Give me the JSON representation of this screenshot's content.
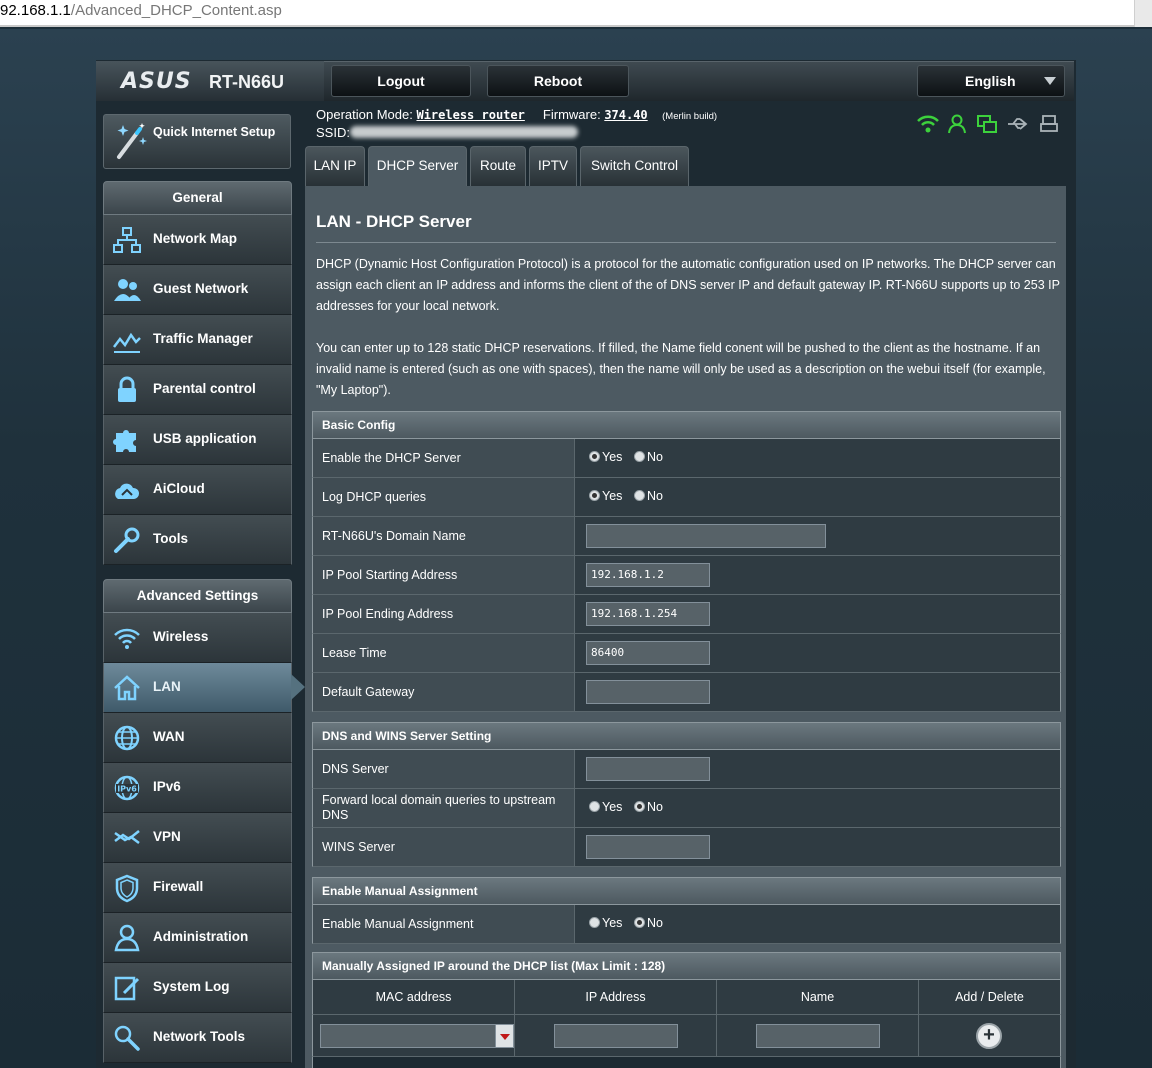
{
  "browser": {
    "url_host": "92.168.1.1",
    "url_path": "/Advanced_DHCP_Content.asp"
  },
  "header": {
    "brand": "ASUS",
    "model": "RT-N66U",
    "logout_label": "Logout",
    "reboot_label": "Reboot",
    "language": "English"
  },
  "status": {
    "operation_mode_label": "Operation Mode:",
    "operation_mode_value": "Wireless router",
    "firmware_label": "Firmware:",
    "firmware_value": "374.40",
    "firmware_note": "(Merlin build)",
    "ssid_label": "SSID:",
    "icons": [
      "wifi-icon",
      "user-icon",
      "network-icon",
      "usb-icon",
      "printer-icon"
    ],
    "icon_colors": {
      "active": "#3cd13c",
      "inactive": "#aab3b8"
    }
  },
  "sidebar": {
    "qis_label": "Quick Internet Setup",
    "general_heading": "General",
    "general_items": [
      {
        "label": "Network Map",
        "icon": "network-map-icon"
      },
      {
        "label": "Guest Network",
        "icon": "guest-network-icon"
      },
      {
        "label": "Traffic Manager",
        "icon": "traffic-manager-icon"
      },
      {
        "label": "Parental control",
        "icon": "lock-icon"
      },
      {
        "label": "USB application",
        "icon": "puzzle-icon"
      },
      {
        "label": "AiCloud",
        "icon": "cloud-icon"
      },
      {
        "label": "Tools",
        "icon": "wrench-icon"
      }
    ],
    "advanced_heading": "Advanced Settings",
    "advanced_items": [
      {
        "label": "Wireless",
        "icon": "wifi-icon"
      },
      {
        "label": "LAN",
        "icon": "home-icon",
        "active": true
      },
      {
        "label": "WAN",
        "icon": "globe-icon"
      },
      {
        "label": "IPv6",
        "icon": "ipv6-icon"
      },
      {
        "label": "VPN",
        "icon": "vpn-icon"
      },
      {
        "label": "Firewall",
        "icon": "shield-icon"
      },
      {
        "label": "Administration",
        "icon": "admin-icon"
      },
      {
        "label": "System Log",
        "icon": "log-icon"
      },
      {
        "label": "Network Tools",
        "icon": "network-tools-icon"
      }
    ]
  },
  "tabs": [
    {
      "label": "LAN IP"
    },
    {
      "label": "DHCP Server",
      "active": true
    },
    {
      "label": "Route"
    },
    {
      "label": "IPTV"
    },
    {
      "label": "Switch Control"
    }
  ],
  "main": {
    "title": "LAN - DHCP Server",
    "desc1": "DHCP (Dynamic Host Configuration Protocol) is a protocol for the automatic configuration used on IP networks. The DHCP server can assign each client an IP address and informs the client of the of DNS server IP and default gateway IP. RT-N66U supports up to 253 IP addresses for your local network.",
    "desc2": "You can enter up to 128 static DHCP reservations. If filled, the Name field conent will be pushed to the client as the hostname. If an invalid name is entered (such as one with spaces), then the name will only be used as a description on the webui itself (for example, \"My Laptop\").",
    "yes": "Yes",
    "no": "No",
    "basic": {
      "heading": "Basic Config",
      "enable_dhcp_label": "Enable the DHCP Server",
      "enable_dhcp_value": "Yes",
      "log_dhcp_label": "Log DHCP queries",
      "log_dhcp_value": "Yes",
      "domain_label": "RT-N66U's Domain Name",
      "domain_value": "",
      "pool_start_label": "IP Pool Starting Address",
      "pool_start_value": "192.168.1.2",
      "pool_end_label": "IP Pool Ending Address",
      "pool_end_value": "192.168.1.254",
      "lease_label": "Lease Time",
      "lease_value": "86400",
      "gateway_label": "Default Gateway",
      "gateway_value": ""
    },
    "dns": {
      "heading": "DNS and WINS Server Setting",
      "dns_label": "DNS Server",
      "dns_value": "",
      "forward_label": "Forward local domain queries to upstream DNS",
      "forward_value": "No",
      "wins_label": "WINS Server",
      "wins_value": ""
    },
    "manual": {
      "heading": "Enable Manual Assignment",
      "enable_label": "Enable Manual Assignment",
      "enable_value": "No"
    },
    "list": {
      "heading": "Manually Assigned IP around the DHCP list (Max Limit : 128)",
      "col_mac": "MAC address",
      "col_ip": "IP Address",
      "col_name": "Name",
      "col_action": "Add / Delete",
      "add_symbol": "+"
    }
  }
}
